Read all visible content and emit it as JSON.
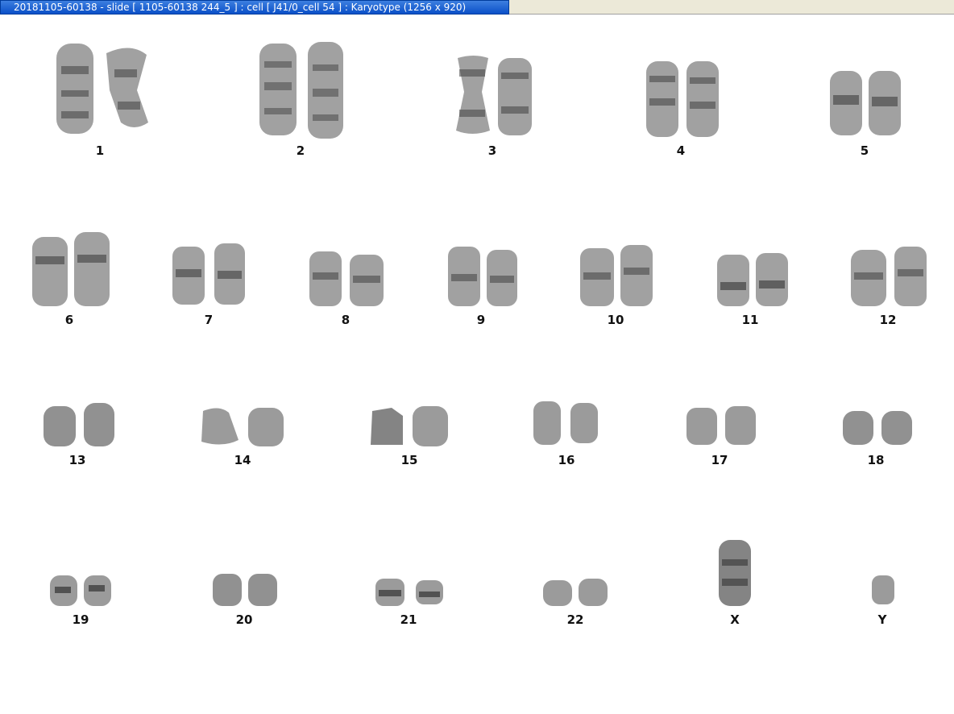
{
  "window": {
    "title": "20181105-60138 - slide [ 1105-60138 244_5 ] : cell [ J41/0_cell 54 ] : Karyotype  (1256 x 920)"
  },
  "karyotype": {
    "chromosomes": [
      "1",
      "2",
      "3",
      "4",
      "5",
      "6",
      "7",
      "8",
      "9",
      "10",
      "11",
      "12",
      "13",
      "14",
      "15",
      "16",
      "17",
      "18",
      "19",
      "20",
      "21",
      "22",
      "X",
      "Y"
    ]
  }
}
